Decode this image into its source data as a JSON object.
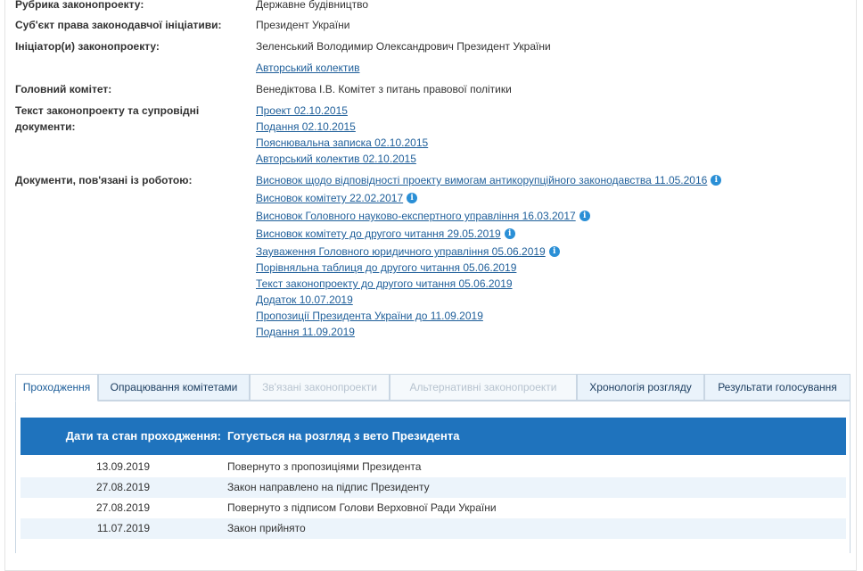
{
  "info": {
    "rubric": {
      "label": "Рубрика законопроекту:",
      "value": "Державне будівництво"
    },
    "subject": {
      "label": "Суб'єкт права законодавчої ініціативи:",
      "value": "Президент України"
    },
    "initiator": {
      "label": "Ініціатор(и) законопроекту:",
      "value": "Зеленський Володимир Олександрович Президент України",
      "link": "Авторський колектив"
    },
    "committee": {
      "label": "Головний комітет:",
      "value": "Венедіктова І.В. Комітет з питань правової політики"
    },
    "texts": {
      "label_line1": "Текст законопроекту та супровідні",
      "label_line2": "документи:",
      "items": [
        "Проект 02.10.2015",
        "Подання 02.10.2015",
        "Пояснювальна записка 02.10.2015",
        "Авторський колектив 02.10.2015"
      ]
    },
    "docs": {
      "label": "Документи, пов'язані із роботою:",
      "items": [
        "Висновок щодо відповідності проекту вимогам антикорупційного законодавства 11.05.2016",
        "Висновок комітету 22.02.2017",
        "Висновок Головного науково-експертного управління 16.03.2017",
        "Висновок комітету до другого читання 29.05.2019",
        "Зауваження Головного юридичного управління 05.06.2019",
        "Порівняльна таблиця до другого читання 05.06.2019",
        "Текст законопроекту до другого читання 05.06.2019",
        "Додаток 10.07.2019",
        "Пропозиції Президента України до 11.09.2019",
        "Подання 11.09.2019"
      ],
      "info_icon_glyph": "i"
    }
  },
  "tabs": [
    "Проходження",
    "Опрацювання комітетами",
    "Зв'язані законопроекти",
    "Альтернативні законопроекти",
    "Хронологія розгляду",
    "Результати голосування"
  ],
  "table": {
    "col1_header": "Дати та стан проходження:",
    "col2_header": "Готується на розгляд з вето Президента",
    "rows": [
      {
        "date": "13.09.2019",
        "text": "Повернуто з пропозиціями Президента"
      },
      {
        "date": "27.08.2019",
        "text": "Закон направлено на підпис Президенту"
      },
      {
        "date": "27.08.2019",
        "text": "Повернуто з підписом Голови Верховної Ради України"
      },
      {
        "date": "11.07.2019",
        "text": "Закон прийнято"
      }
    ]
  },
  "colors": {
    "link": "#1f5f9a",
    "header_bg": "#1f73bd",
    "info_icon": "#2a8fd6",
    "row_alt": "#ecf4fb"
  }
}
